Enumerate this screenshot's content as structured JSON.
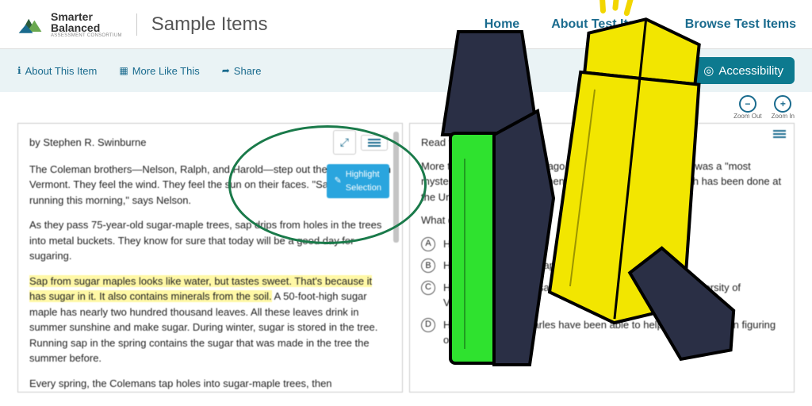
{
  "header": {
    "logo_l1": "Smarter",
    "logo_l2": "Balanced",
    "logo_sub": "ASSESSMENT CONSORTIUM",
    "sample_title": "Sample Items"
  },
  "nav": {
    "home": "Home",
    "about": "About Test Items",
    "browse": "Browse Test Items"
  },
  "subnav": {
    "about_item": "About This Item",
    "more_like": "More Like This",
    "share": "Share",
    "accessibility": "Accessibility"
  },
  "zoom": {
    "out": "Zoom Out",
    "in": "Zoom In"
  },
  "popup": {
    "highlight": "Highlight Selection"
  },
  "passage": {
    "byline": "by Stephen R. Swinburne",
    "p1": "The Coleman brothers—Nelson, Ralph, and Harold—step out their front door in Vermont. They feel the wind. They feel the sun on their faces. \"Sap could be running this morning,\" says Nelson.",
    "p2": "As they pass 75-year-old sugar-maple trees, sap drips from holes in the trees into metal buckets. They know for sure that today will be a good day for sugaring.",
    "p3a": "Sap from sugar maples looks like water, but tastes sweet. That's because it has sugar in it. It also contains minerals from the soil.",
    "p3b": " A 50-foot-high sugar maple has nearly two hundred thousand leaves. All these leaves drink in summer sunshine and make sugar. During winter, sugar is stored in the tree. Running sap in the spring contains the sugar that was made in the tree the summer before.",
    "p4": "Every spring, the Colemans tap holes into sugar-maple trees, then"
  },
  "question": {
    "intro": "Read the sentences",
    "stem": "More than a hundred years ago, one scientist said sugaring was a \"most mysterious subject.\" Since then, much sugar-maple research has been done at the University of Vermont.",
    "prompt": "What does this paragraph",
    "choices": [
      {
        "letter": "A",
        "text": "He believes that no"
      },
      {
        "letter": "B",
        "text": "He believes the way sap flows helps."
      },
      {
        "letter": "C",
        "text": "He believes the way sap flows has been done at the University of Vermont."
      },
      {
        "letter": "D",
        "text": "He believes that Charles have been able to help the University in figuring out"
      }
    ]
  }
}
